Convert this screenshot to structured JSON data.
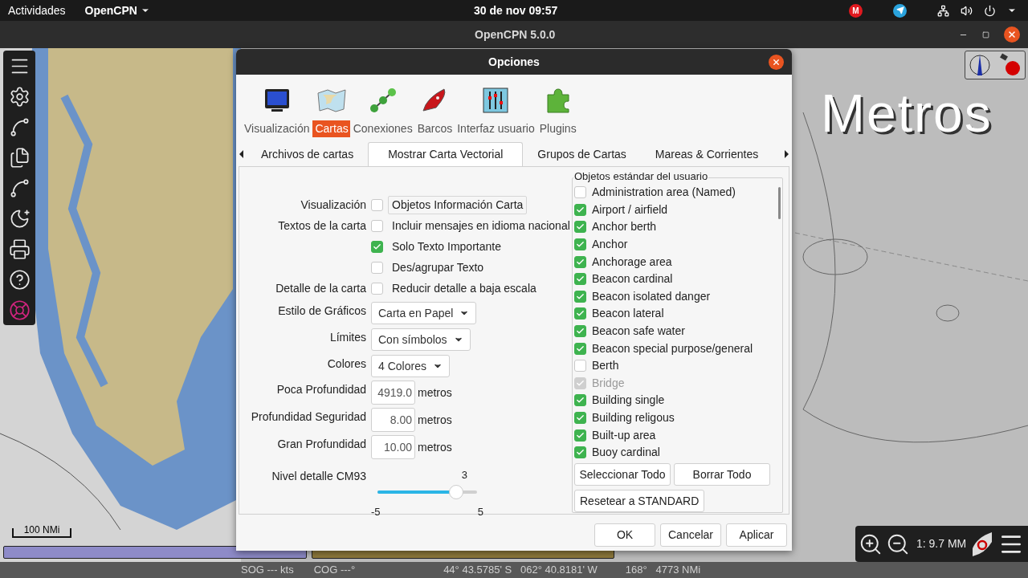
{
  "top_bar": {
    "activities": "Actividades",
    "app": "OpenCPN",
    "clock": "30 de nov  09:57",
    "tray_letter": "M"
  },
  "title_bar": {
    "title": "OpenCPN 5.0.0"
  },
  "chart": {
    "overlay_text": "Metros",
    "scale": "100 NMi",
    "zoom_readout": "1: 9.7 MM",
    "quilt_bars": [
      {
        "color": "#8e8bc8"
      },
      {
        "color": "#8f7a3c"
      }
    ]
  },
  "status_bar": [
    "SOG --- kts",
    "COG ---°",
    "44° 43.5785' S   062° 40.8181' W",
    "168°   4773 NMi"
  ],
  "dialog": {
    "title": "Opciones",
    "categories": [
      {
        "label": "Visualización",
        "selected": false
      },
      {
        "label": "Cartas",
        "selected": true
      },
      {
        "label": "Conexiones",
        "selected": false
      },
      {
        "label": "Barcos",
        "selected": false
      },
      {
        "label": "Interfaz usuario",
        "selected": false
      },
      {
        "label": "Plugins",
        "selected": false
      }
    ],
    "tabs": [
      {
        "label": "Archivos de cartas",
        "selected": false
      },
      {
        "label": "Mostrar Carta Vectorial",
        "selected": true
      },
      {
        "label": "Grupos de Cartas",
        "selected": false
      },
      {
        "label": "Mareas & Corrientes",
        "selected": false
      }
    ],
    "settings": [
      {
        "kind": "checkbox",
        "label": "Visualización",
        "text": "Objetos Información Carta",
        "checked": false,
        "focused": true
      },
      {
        "kind": "checkbox",
        "label": "Textos de la carta",
        "text": "Incluir mensajes en idioma nacional",
        "checked": false,
        "focused": false
      },
      {
        "kind": "checkbox",
        "text": "Solo Texto Importante",
        "checked": true,
        "focused": false
      },
      {
        "kind": "checkbox",
        "text": "Des/agrupar Texto",
        "checked": false,
        "focused": false
      },
      {
        "kind": "checkbox",
        "label": "Detalle de la carta",
        "text": "Reducir detalle a baja escala",
        "checked": false,
        "focused": false
      },
      {
        "kind": "dropdown",
        "label": "Estilo de Gráficos",
        "value": "Carta en Papel"
      },
      {
        "kind": "dropdown",
        "label": "Límites",
        "value": "Con símbolos"
      },
      {
        "kind": "dropdown",
        "label": "Colores",
        "value": "4 Colores"
      },
      {
        "kind": "number",
        "label": "Poca Profundidad",
        "value": "4919.0",
        "unit": "metros"
      },
      {
        "kind": "number",
        "label": "Profundidad Seguridad",
        "value": "8.00",
        "unit": "metros"
      },
      {
        "kind": "number",
        "label": "Gran Profundidad",
        "value": "10.00",
        "unit": "metros"
      },
      {
        "kind": "slider",
        "label": "Nivel detalle CM93",
        "value": "3",
        "min": "-5",
        "max": "5",
        "level": 0.8
      }
    ],
    "objects": {
      "title": "Objetos estándar del usuario",
      "items": [
        {
          "label": "Administration area (Named)",
          "checked": false,
          "disabled": false
        },
        {
          "label": "Airport / airfield",
          "checked": true,
          "disabled": false
        },
        {
          "label": "Anchor berth",
          "checked": true,
          "disabled": false
        },
        {
          "label": "Anchor",
          "checked": true,
          "disabled": false
        },
        {
          "label": "Anchorage area",
          "checked": true,
          "disabled": false
        },
        {
          "label": "Beacon cardinal",
          "checked": true,
          "disabled": false
        },
        {
          "label": "Beacon isolated danger",
          "checked": true,
          "disabled": false
        },
        {
          "label": "Beacon lateral",
          "checked": true,
          "disabled": false
        },
        {
          "label": "Beacon safe water",
          "checked": true,
          "disabled": false
        },
        {
          "label": "Beacon special purpose/general",
          "checked": true,
          "disabled": false
        },
        {
          "label": "Berth",
          "checked": false,
          "disabled": false
        },
        {
          "label": "Bridge",
          "checked": true,
          "disabled": true
        },
        {
          "label": "Building single",
          "checked": true,
          "disabled": false
        },
        {
          "label": "Building religous",
          "checked": true,
          "disabled": false
        },
        {
          "label": "Built-up area",
          "checked": true,
          "disabled": false
        },
        {
          "label": "Buoy cardinal",
          "checked": true,
          "disabled": false
        }
      ],
      "buttons": [
        "Seleccionar Todo",
        "Borrar Todo",
        "Resetear a STANDARD"
      ]
    },
    "buttons": [
      "OK",
      "Cancelar",
      "Aplicar"
    ]
  }
}
